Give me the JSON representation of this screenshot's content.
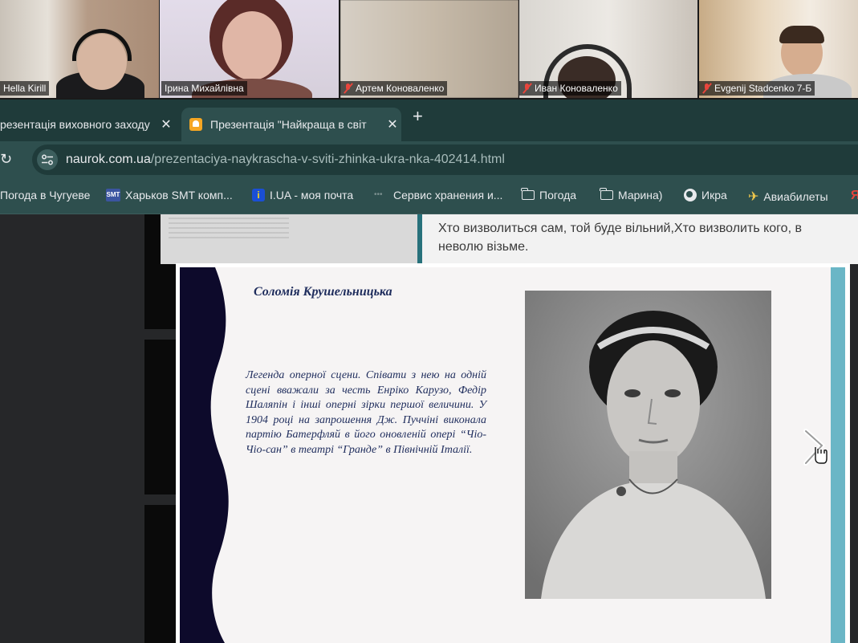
{
  "video_call": {
    "participants": [
      {
        "name": "Hella Kirill",
        "muted": false
      },
      {
        "name": "Ірина Михайлівна",
        "muted": false,
        "speaking": true
      },
      {
        "name": "Артем Коноваленко",
        "muted": true
      },
      {
        "name": "Иван Коноваленко",
        "muted": true
      },
      {
        "name": "Evgenij Stadcenko 7-Б",
        "muted": true
      }
    ],
    "speaking_color": "#3ed17a",
    "muted_color": "#e8453c"
  },
  "browser": {
    "tabs": [
      {
        "title": "резентація виховного заходу",
        "active": false
      },
      {
        "title": "Презентація \"Найкраща в світ",
        "active": true,
        "icon": "bell-icon"
      }
    ],
    "new_tab_label": "+",
    "close_label": "✕",
    "reload_label": "↻",
    "address": {
      "domain": "naurok.com.ua",
      "path": "/prezentaciya-naykrascha-v-sviti-zhinka-ukra-nka-402414.html"
    },
    "bookmarks": [
      {
        "label": "Погода в Чугуеве",
        "icon": "none"
      },
      {
        "label": "Харьков SMT комп...",
        "icon": "smt-icon"
      },
      {
        "label": "I.UA - моя почта",
        "icon": "iua-icon"
      },
      {
        "label": "Сервис хранения и...",
        "icon": "dots-icon"
      },
      {
        "label": "Погода",
        "icon": "folder-icon"
      },
      {
        "label": "Марина)",
        "icon": "folder-icon"
      },
      {
        "label": "Икра",
        "icon": "globe-icon"
      },
      {
        "label": "Авиабилеты",
        "icon": "plane-icon"
      },
      {
        "label": "Я",
        "icon": "yandex-icon"
      }
    ],
    "theme_color": "#2e4f4e"
  },
  "page": {
    "quote": "Хто визволиться сам, той буде вільний,Хто визволить кого, в неволю візьме.",
    "slide": {
      "title": "Соломія Крушельницька",
      "body": "Легенда оперної сцени.  Співати з нею на одній сцені вважали за честь Енріко Карузо, Федір Шаляпін і інші оперні зірки першої величини. У 1904 році на запрошення Дж. Пуччіні виконала партію Батерфляй в його оновленій опері  “Чіо-Чіо-сан”  в  театрі  “Гранде” в Північній Італії.",
      "accent_dark": "#0d0a2b",
      "accent_right": "#6ab6c6"
    }
  }
}
